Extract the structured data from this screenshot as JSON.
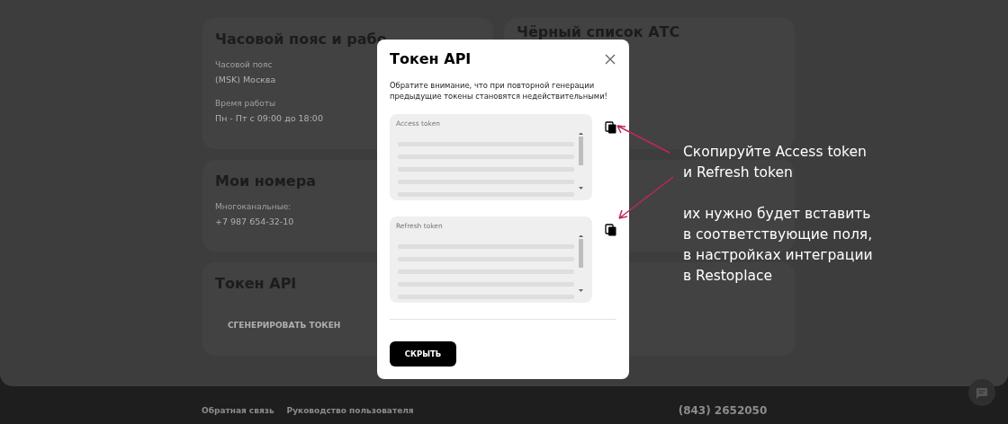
{
  "cards": [
    {
      "title": "Часовой пояс и рабо",
      "fields": [
        {
          "label": "Часовой пояс",
          "value": "(MSK) Москва"
        },
        {
          "label": "Время работы",
          "value": "Пн - Пт с 09:00 до 18:00"
        }
      ]
    },
    {
      "title": "Чёрный список АТС"
    },
    {
      "title": "Мои номера",
      "fields": [
        {
          "label": "Многоканальные:",
          "value": "+7 987 654-32-10"
        }
      ]
    },
    {
      "title": "Токен API",
      "action": "СГЕНЕРИРОВАТЬ ТОКЕН"
    }
  ],
  "footer": {
    "links": [
      "Обратная связь",
      "Руководство пользователя"
    ],
    "phone": "(843) 2652050"
  },
  "modal": {
    "title": "Токен API",
    "notice": "Обратите внимание, что при повторной генерации предыдущие токены становятся недействительными!",
    "tokens": [
      {
        "label": "Access token"
      },
      {
        "label": "Refresh token"
      }
    ],
    "button": "СКРЫТЬ"
  },
  "annotation": {
    "lines": [
      "Скопируйте Access token",
      "и Refresh token"
    ],
    "note": [
      "их нужно будет вставить",
      "в соответствующие поля,",
      "в настройках интеграции",
      "в Restoplace"
    ]
  }
}
